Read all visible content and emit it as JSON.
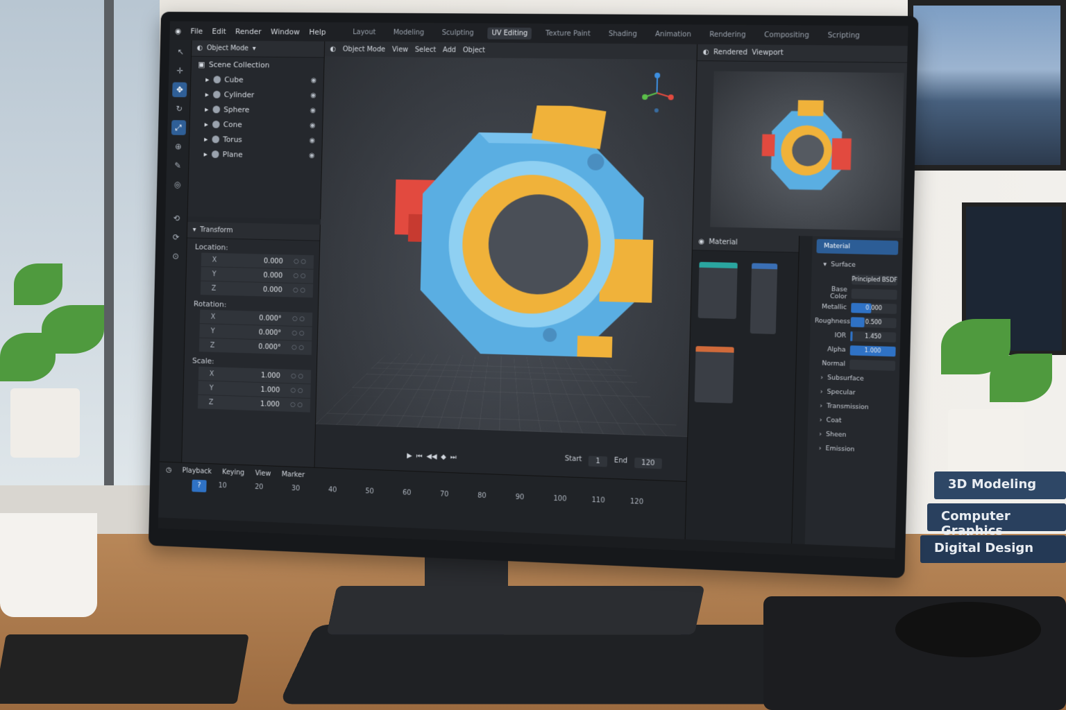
{
  "menu": [
    "File",
    "Edit",
    "Render",
    "Window",
    "Help"
  ],
  "workspaces": [
    "Layout",
    "Modeling",
    "Sculpting",
    "UV Editing",
    "Texture Paint",
    "Shading",
    "Animation",
    "Rendering",
    "Compositing",
    "Scripting"
  ],
  "active_workspace": "UV Editing",
  "outliner": {
    "mode": "Object Mode",
    "collection": "Scene Collection",
    "items": [
      "Cube",
      "Cylinder",
      "Sphere",
      "Cone",
      "Torus",
      "Plane"
    ]
  },
  "transform": {
    "title": "Transform",
    "location_label": "Location:",
    "location": [
      {
        "axis": "X",
        "value": "0.000"
      },
      {
        "axis": "Y",
        "value": "0.000"
      },
      {
        "axis": "Z",
        "value": "0.000"
      }
    ],
    "rotation_label": "Rotation:",
    "rotation": [
      {
        "axis": "X",
        "value": "0.000°"
      },
      {
        "axis": "Y",
        "value": "0.000°"
      },
      {
        "axis": "Z",
        "value": "0.000°"
      }
    ],
    "scale_label": "Scale:",
    "scale": [
      {
        "axis": "X",
        "value": "1.000"
      },
      {
        "axis": "Y",
        "value": "1.000"
      },
      {
        "axis": "Z",
        "value": "1.000"
      }
    ]
  },
  "viewport": {
    "mode": "Object Mode",
    "menus": [
      "View",
      "Select",
      "Add",
      "Object"
    ]
  },
  "timeline": {
    "menus": [
      "Playback",
      "Keying",
      "View",
      "Marker"
    ],
    "ticks": [
      "10",
      "20",
      "30",
      "40",
      "50",
      "60",
      "70",
      "80",
      "90",
      "100",
      "110",
      "120"
    ],
    "current_frame": "?",
    "start_label": "Start",
    "start": "1",
    "end_label": "End",
    "end": "120"
  },
  "preview": {
    "header": "Rendered",
    "extra": "Viewport"
  },
  "material_panel": {
    "title": "Material",
    "header": "Material",
    "surface_label": "Surface",
    "shader": "Principled BSDF",
    "props": [
      {
        "label": "Base Color",
        "value": "",
        "fill": 0
      },
      {
        "label": "Metallic",
        "value": "0.000",
        "fill": 0.45
      },
      {
        "label": "Roughness",
        "value": "0.500",
        "fill": 0.3
      },
      {
        "label": "IOR",
        "value": "1.450",
        "fill": 0.05
      },
      {
        "label": "Alpha",
        "value": "1.000",
        "fill": 1.0
      },
      {
        "label": "Normal",
        "value": "",
        "fill": 0
      }
    ],
    "sections": [
      "Subsurface",
      "Specular",
      "Transmission",
      "Coat",
      "Sheen",
      "Emission"
    ]
  },
  "books": [
    "3D Modeling",
    "Computer Graphics",
    "Digital Design"
  ],
  "colors": {
    "accent": "#2f72c5",
    "model_blue": "#5aaee2",
    "model_yellow": "#f0b23a",
    "model_red": "#e24a3f"
  }
}
